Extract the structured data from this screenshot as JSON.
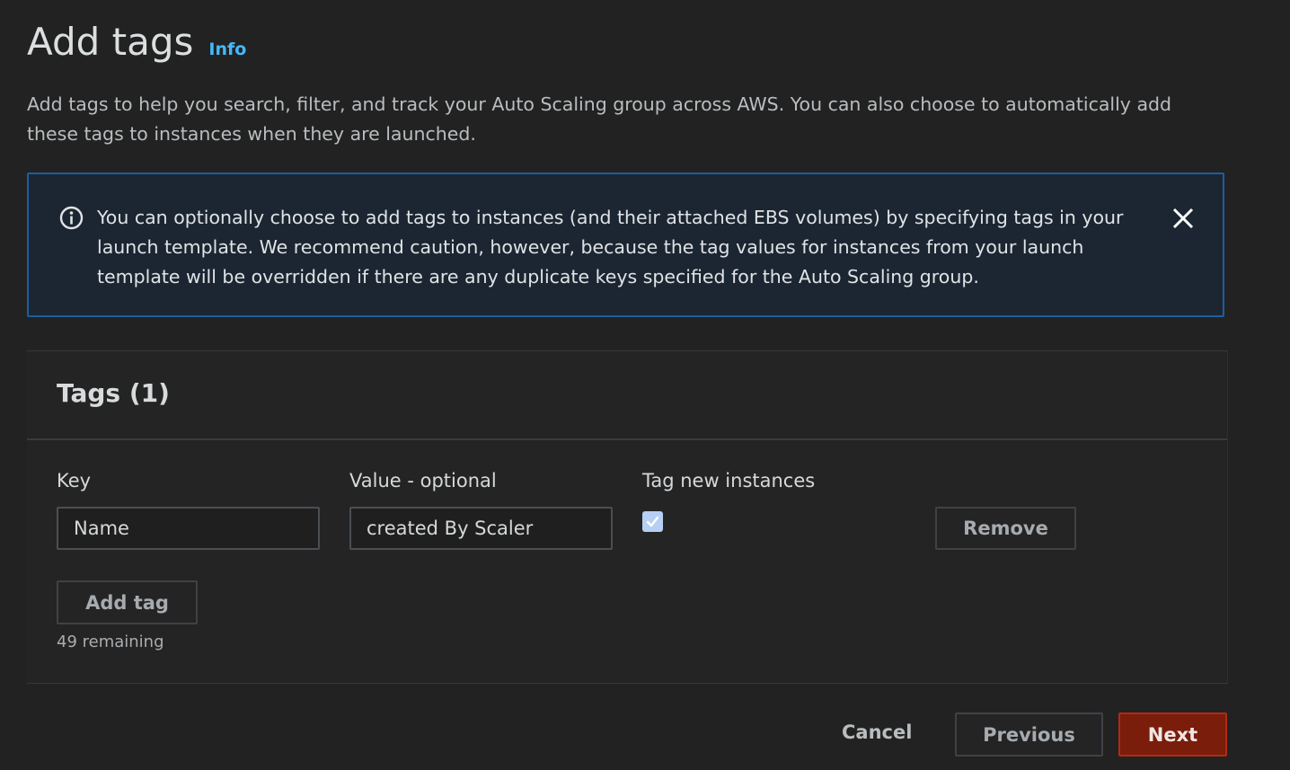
{
  "header": {
    "title": "Add tags",
    "info_link": "Info",
    "description": "Add tags to help you search, filter, and track your Auto Scaling group across AWS. You can also choose to automatically add these tags to instances when they are launched."
  },
  "alert": {
    "icon": "info-circle-icon",
    "text": "You can optionally choose to add tags to instances (and their attached EBS volumes) by specifying tags in your launch template. We recommend caution, however, because the tag values for instances from your launch template will be overridden if there are any duplicate keys specified for the Auto Scaling group.",
    "close_icon": "close-icon"
  },
  "tags": {
    "title": "Tags (1)",
    "columns": {
      "key": "Key",
      "value": "Value - optional",
      "tag_new_instances": "Tag new instances"
    },
    "rows": [
      {
        "key": "Name",
        "value": "created By Scaler",
        "tag_new_instances": true,
        "remove_label": "Remove"
      }
    ],
    "add_tag_label": "Add tag",
    "remaining": "49 remaining"
  },
  "footer": {
    "cancel_label": "Cancel",
    "previous_label": "Previous",
    "next_label": "Next"
  },
  "colors": {
    "background": "#222222",
    "link": "#44b9ff",
    "alert_border": "#1c5ea1",
    "primary_button": "#7a1d0b",
    "checkbox": "#b6cff4"
  }
}
